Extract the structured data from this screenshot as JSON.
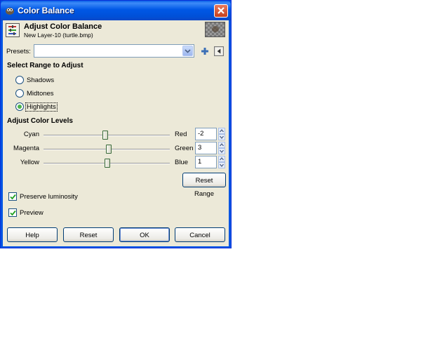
{
  "window": {
    "title": "Color Balance"
  },
  "header": {
    "title": "Adjust Color Balance",
    "subtitle": "New Layer-10 (turtle.bmp)"
  },
  "presets": {
    "label": "Presets:",
    "value": ""
  },
  "range": {
    "heading": "Select Range to Adjust",
    "options": [
      "Shadows",
      "Midtones",
      "Highlights"
    ],
    "selected": "Highlights"
  },
  "levels": {
    "heading": "Adjust Color Levels",
    "rows": [
      {
        "left": "Cyan",
        "right": "Red",
        "value": "-2",
        "level": -2
      },
      {
        "left": "Magenta",
        "right": "Green",
        "value": "3",
        "level": 3
      },
      {
        "left": "Yellow",
        "right": "Blue",
        "value": "1",
        "level": 1
      }
    ],
    "range": [
      -100,
      100
    ],
    "reset_range_label": "Reset Range"
  },
  "options": {
    "preserve_luminosity": {
      "label": "Preserve luminosity",
      "checked": true
    },
    "preview": {
      "label": "Preview",
      "checked": true
    }
  },
  "buttons": {
    "help": "Help",
    "reset": "Reset",
    "ok": "OK",
    "cancel": "Cancel"
  },
  "colors": {
    "title_bar": "#0054e3",
    "dialog_bg": "#ece9d8",
    "radio_dot": "#4bb44b"
  }
}
